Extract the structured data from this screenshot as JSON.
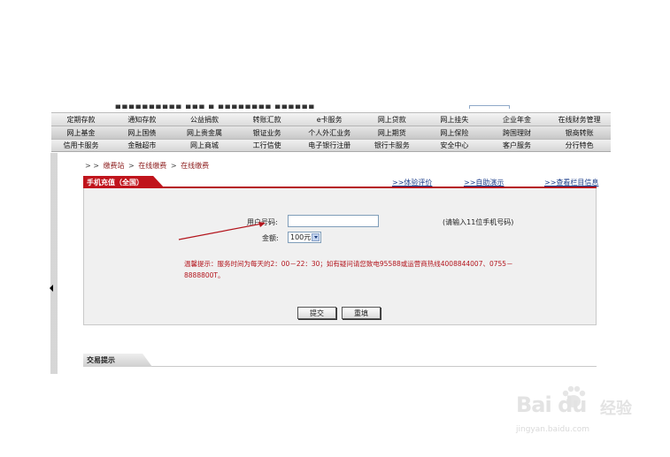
{
  "top_strip_text": "■■■■■■■■■■  ■■■ ■ ■■■■■■■■  ■■■■■■",
  "nav": {
    "rows": [
      [
        "定期存款",
        "通知存款",
        "公益捐款",
        "转账汇款",
        "e卡服务",
        "网上贷款",
        "网上挂失",
        "企业年金",
        "在线财务管理"
      ],
      [
        "网上基金",
        "网上国债",
        "网上贵金属",
        "银证业务",
        "个人外汇业务",
        "网上期货",
        "网上保险",
        "跨国理财",
        "银商转账"
      ],
      [
        "信用卡服务",
        "金融超市",
        "网上商城",
        "工行信使",
        "电子银行注册",
        "银行卡服务",
        "安全中心",
        "客户服务",
        "分行特色"
      ]
    ]
  },
  "breadcrumb": {
    "prefix": "> >",
    "items": [
      "缴费站",
      "在线缴费",
      "在线缴费"
    ],
    "separator": ">"
  },
  "panel": {
    "tab_label": "手机充值（全国）",
    "links": [
      ">>体验评价",
      ">>自助演示",
      ">>查看栏目信息"
    ]
  },
  "form": {
    "user_label": "用户号码:",
    "user_value": "",
    "user_hint": "(请输入11位手机号码)",
    "amount_label": "金额:",
    "amount_selected": "100元",
    "notice": "温馨提示：服务时间为每天的2：00－22：30；如有疑问请您致电95588或运营商热线4008844007、0755－8888800T。",
    "submit_label": "提交",
    "reset_label": "重填"
  },
  "bottom_tab_label": "交易提示",
  "watermark": {
    "logo": "Bai du",
    "cn": "经验",
    "url": "jingyan.baidu.com"
  },
  "colors": {
    "accent_red": "#c0141c",
    "link_blue": "#1a3c8a",
    "panel_bg": "#f0f0f0"
  }
}
